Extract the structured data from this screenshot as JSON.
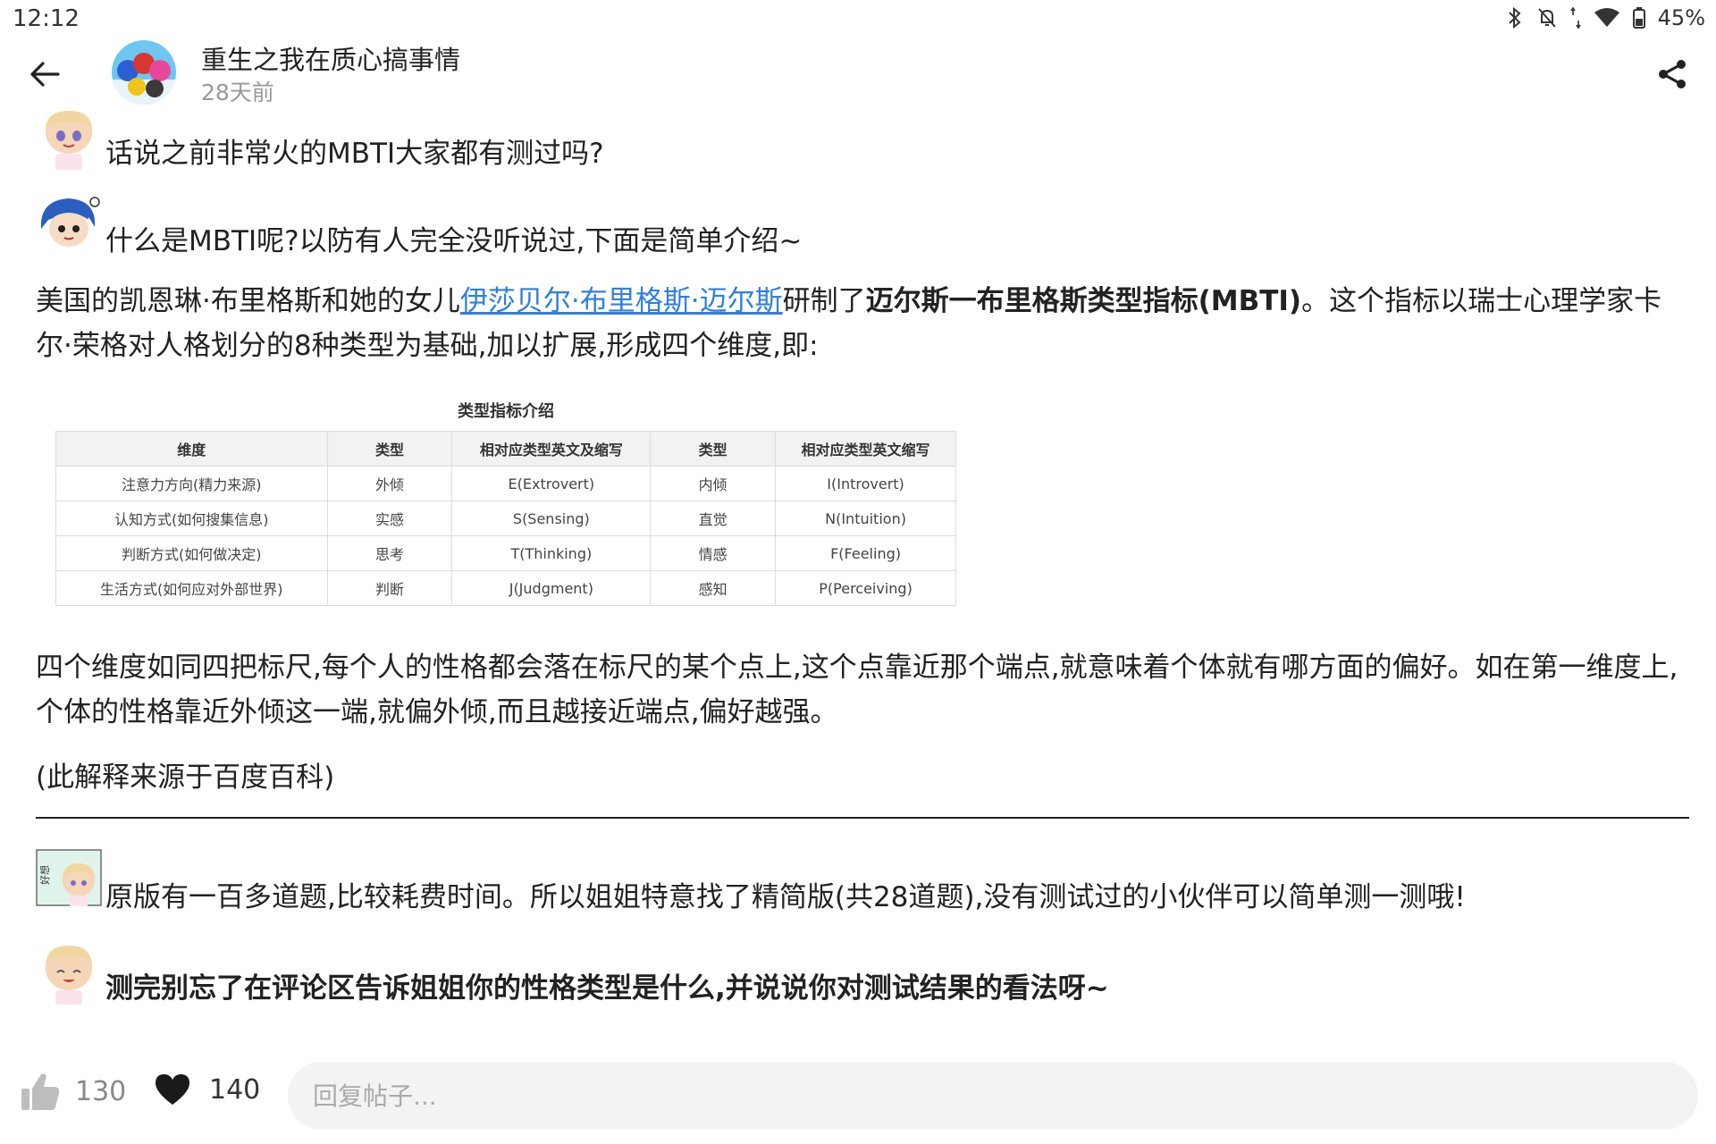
{
  "status_bar": {
    "time": "12:12",
    "battery": "45%"
  },
  "header": {
    "author_name": "重生之我在质心搞事情",
    "post_time": "28天前"
  },
  "post": {
    "line1": "话说之前非常火的MBTI大家都有测过吗?",
    "line2": "什么是MBTI呢?以防有人完全没听说过,下面是简单介绍~",
    "intro_part1": "美国的凯恩琳·布里格斯和她的女儿",
    "intro_link": "伊莎贝尔·布里格斯·迈尔斯",
    "intro_part2": "研制了",
    "intro_bold": "迈尔斯一布里格斯类型指标(MBTI)",
    "intro_part3": "。这个指标以瑞士心理学家卡尔·荣格对人格划分的8种类型为基础,加以扩展,形成四个维度,即:",
    "explain": "四个维度如同四把标尺,每个人的性格都会落在标尺的某个点上,这个点靠近那个端点,就意味着个体就有哪方面的偏好。如在第一维度上,个体的性格靠近外倾这一端,就偏外倾,而且越接近端点,偏好越强。",
    "source": "(此解释来源于百度百科)",
    "line3": "原版有一百多道题,比较耗费时间。所以姐姐特意找了精简版(共28道题),没有测试过的小伙伴可以简单测一测哦!",
    "line4": "测完别忘了在评论区告诉姐姐你的性格类型是什么,并说说你对测试结果的看法呀~",
    "sticker_text": "好想"
  },
  "table": {
    "title": "类型指标介绍",
    "headers": [
      "维度",
      "类型",
      "相对应类型英文及缩写",
      "类型",
      "相对应类型英文缩写"
    ],
    "rows": [
      [
        "注意力方向(精力来源)",
        "外倾",
        "E(Extrovert)",
        "内倾",
        "I(Introvert)"
      ],
      [
        "认知方式(如何搜集信息)",
        "实感",
        "S(Sensing)",
        "直觉",
        "N(Intuition)"
      ],
      [
        "判断方式(如何做决定)",
        "思考",
        "T(Thinking)",
        "情感",
        "F(Feeling)"
      ],
      [
        "生活方式(如何应对外部世界)",
        "判断",
        "J(Judgment)",
        "感知",
        "P(Perceiving)"
      ]
    ]
  },
  "bottom_bar": {
    "like_count": "130",
    "fav_count": "140",
    "reply_placeholder": "回复帖子..."
  },
  "icons": {
    "back": "arrow-left-icon",
    "share": "share-icon",
    "like": "thumbs-up-icon",
    "favorite": "heart-icon"
  },
  "colors": {
    "link": "#2f7fe0",
    "divider": "#222222",
    "input_bg": "#f3f3f3"
  }
}
